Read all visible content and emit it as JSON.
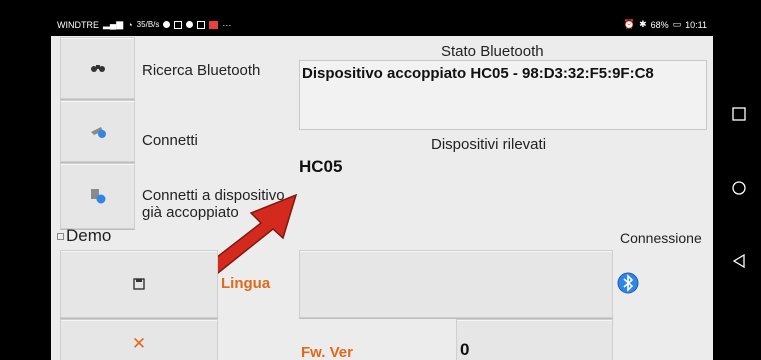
{
  "statusbar": {
    "carrier": "WINDTRE",
    "speed_top": "35",
    "speed_unit": "B/s",
    "more": "···",
    "battery": "68%",
    "time": "10:11"
  },
  "buttons": {
    "search_label": "Ricerca Bluetooth",
    "connect_label": "Connetti",
    "connect_paired_label": "Connetti a dispositivo già accoppiato"
  },
  "bluetooth_status": {
    "title": "Stato Bluetooth",
    "value": "Dispositivo accoppiato HC05 - 98:D3:32:F5:9F:C8"
  },
  "devices": {
    "title": "Dispositivi rilevati",
    "items": [
      "HC05"
    ]
  },
  "demo_label": "Demo",
  "connection_label": "Connessione",
  "language": {
    "label": "Lingua",
    "value": ""
  },
  "fw": {
    "label": "Fw. Ver",
    "value": "0"
  },
  "colors": {
    "accent": "#e06a1b",
    "arrow": "#d42a1e",
    "bt": "#2f86e3"
  }
}
